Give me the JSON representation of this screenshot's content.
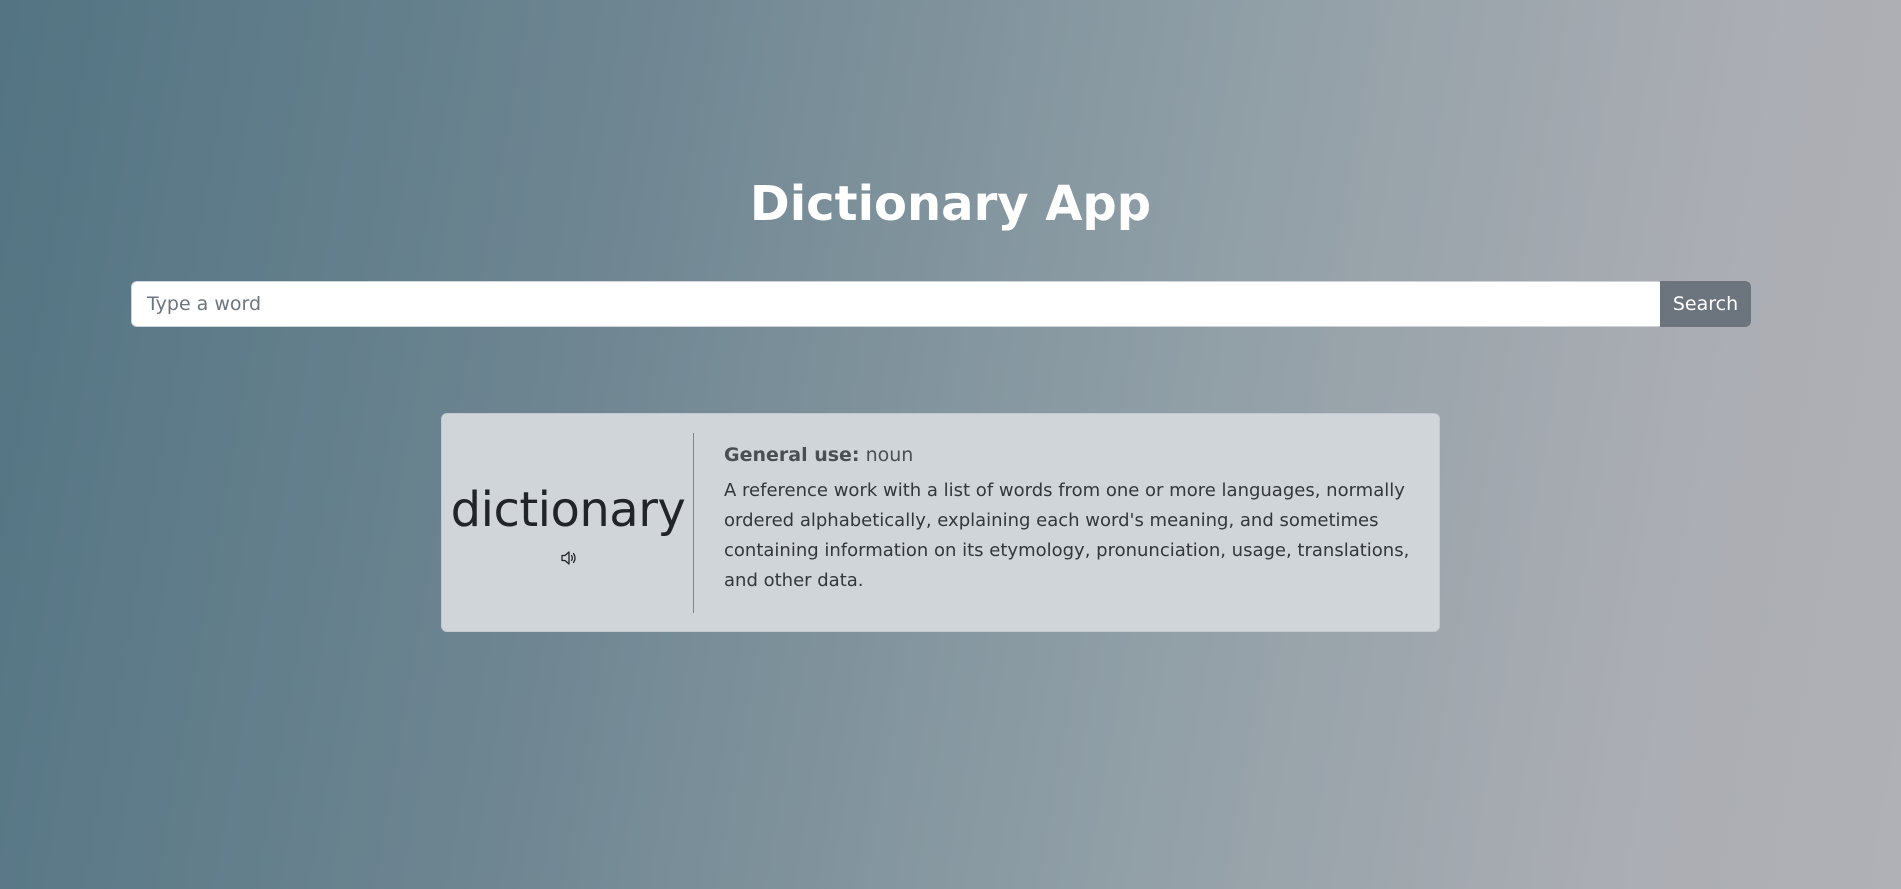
{
  "app": {
    "title": "Dictionary App"
  },
  "search": {
    "placeholder": "Type a word",
    "value": "",
    "button_label": "Search"
  },
  "result": {
    "word": "dictionary",
    "audio_icon": "speaker-icon",
    "part_of_speech_label": "General use:",
    "part_of_speech": "noun",
    "definition": "A reference work with a list of words from one or more languages, normally ordered alphabetically, explaining each word's meaning, and sometimes containing information on its etymology, pronunciation, usage, translations, and other data."
  },
  "colors": {
    "gradient_start": "#537483",
    "gradient_end": "#b0b1b6",
    "card_background": "#d0d5da",
    "button_background": "#6c757d"
  }
}
